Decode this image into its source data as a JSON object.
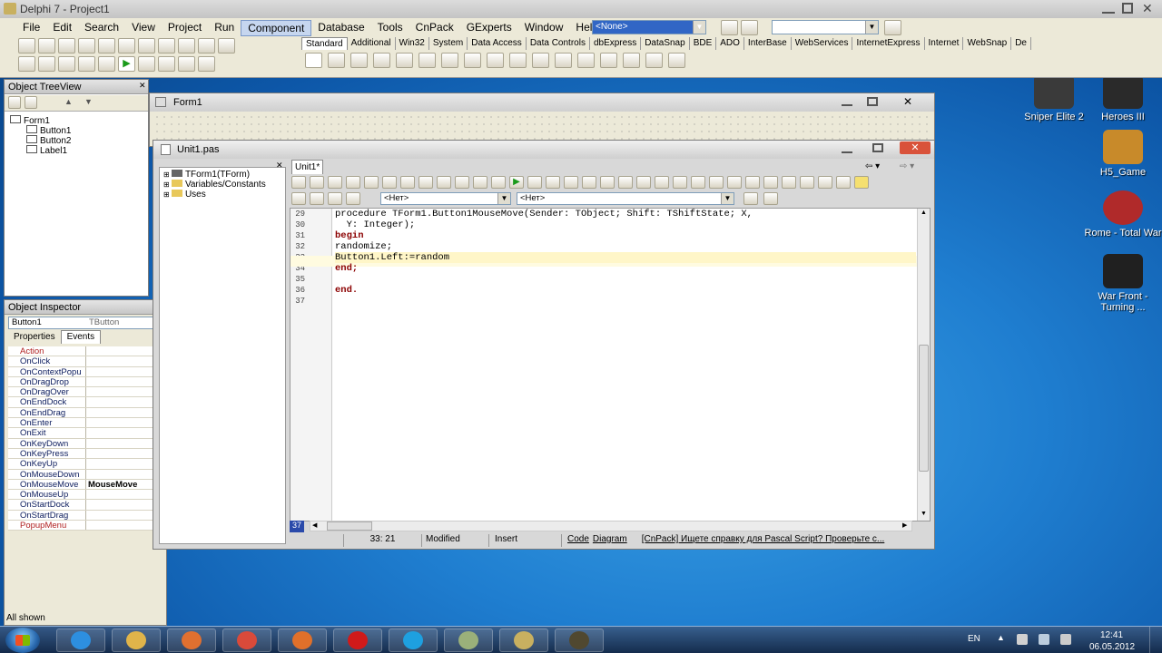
{
  "main_window": {
    "title": "Delphi 7 - Project1",
    "menu": [
      "File",
      "Edit",
      "Search",
      "View",
      "Project",
      "Run",
      "Component",
      "Database",
      "Tools",
      "CnPack",
      "GExperts",
      "Window",
      "Help"
    ],
    "config_combo": "<None>",
    "palette_tabs": [
      "Standard",
      "Additional",
      "Win32",
      "System",
      "Data Access",
      "Data Controls",
      "dbExpress",
      "DataSnap",
      "BDE",
      "ADO",
      "InterBase",
      "WebServices",
      "InternetExpress",
      "Internet",
      "WebSnap",
      "De"
    ]
  },
  "object_tree": {
    "title": "Object TreeView",
    "items": [
      "Form1",
      "Button1",
      "Button2",
      "Label1"
    ]
  },
  "object_inspector": {
    "title": "Object Inspector",
    "selected_object": "Button1",
    "selected_type": "TButton",
    "tabs": [
      "Properties",
      "Events"
    ],
    "rows": [
      {
        "name": "Action",
        "value": ""
      },
      {
        "name": "OnClick",
        "value": ""
      },
      {
        "name": "OnContextPopu",
        "value": ""
      },
      {
        "name": "OnDragDrop",
        "value": ""
      },
      {
        "name": "OnDragOver",
        "value": ""
      },
      {
        "name": "OnEndDock",
        "value": ""
      },
      {
        "name": "OnEndDrag",
        "value": ""
      },
      {
        "name": "OnEnter",
        "value": ""
      },
      {
        "name": "OnExit",
        "value": ""
      },
      {
        "name": "OnKeyDown",
        "value": ""
      },
      {
        "name": "OnKeyPress",
        "value": ""
      },
      {
        "name": "OnKeyUp",
        "value": ""
      },
      {
        "name": "OnMouseDown",
        "value": ""
      },
      {
        "name": "OnMouseMove",
        "value": "MouseMove"
      },
      {
        "name": "OnMouseUp",
        "value": ""
      },
      {
        "name": "OnStartDock",
        "value": ""
      },
      {
        "name": "OnStartDrag",
        "value": ""
      },
      {
        "name": "PopupMenu",
        "value": ""
      }
    ],
    "status": "All shown"
  },
  "form_window": {
    "title": "Form1"
  },
  "editor": {
    "title": "Unit1.pas",
    "tab": "Unit1*",
    "explorer": [
      "TForm1(TForm)",
      "Variables/Constants",
      "Uses"
    ],
    "combo1": "<Нет>",
    "combo2": "<Нет>",
    "lines": [
      {
        "num": "29",
        "text": "procedure TForm1.Button1MouseMove(Sender: TObject; Shift: TShiftState; X,"
      },
      {
        "num": "30",
        "text": "  Y: Integer);"
      },
      {
        "num": "31",
        "text": "begin"
      },
      {
        "num": "32",
        "text": "randomize;"
      },
      {
        "num": "33",
        "text": "Button1.Left:=random"
      },
      {
        "num": "34",
        "text": "end;"
      },
      {
        "num": "35",
        "text": ""
      },
      {
        "num": "36",
        "text": "end."
      },
      {
        "num": "37",
        "text": ""
      }
    ],
    "gutter_marker": "37",
    "status": {
      "position": "33:  21",
      "modified": "Modified",
      "mode": "Insert",
      "tab_code": "Code",
      "tab_diagram": "Diagram",
      "hint": "[CnPack] Ищете справку для Pascal Script? Проверьте с..."
    }
  },
  "desktop_icons": [
    {
      "label": "Sniper Elite 2",
      "color": "#3a3a3a"
    },
    {
      "label": "Heroes III",
      "color": "#2a2a2a"
    },
    {
      "label": "H5_Game",
      "color": "#c88a2a"
    },
    {
      "label": "Rome - Total War",
      "color": "#b02a2a"
    },
    {
      "label": "War Front - Turning ...",
      "color": "#202020"
    }
  ],
  "taskbar": {
    "language": "EN",
    "time": "12:41",
    "date": "06.05.2012",
    "buttons": [
      {
        "name": "ie-icon",
        "color": "#2d8fe0"
      },
      {
        "name": "explorer-icon",
        "color": "#e0b44a"
      },
      {
        "name": "media-player-icon",
        "color": "#e07030"
      },
      {
        "name": "chrome-icon",
        "color": "#d94a3a"
      },
      {
        "name": "firefox-icon",
        "color": "#e0702a"
      },
      {
        "name": "opera-icon",
        "color": "#d01a1a"
      },
      {
        "name": "skype-icon",
        "color": "#1ea0e0"
      },
      {
        "name": "folder-app-icon",
        "color": "#9ab07a"
      },
      {
        "name": "delphi-icon",
        "color": "#c8b060"
      },
      {
        "name": "app-icon",
        "color": "#504830"
      }
    ]
  }
}
